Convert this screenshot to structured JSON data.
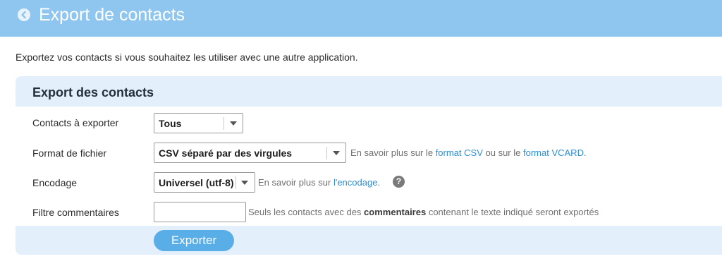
{
  "header": {
    "title": "Export de contacts",
    "back_icon": "back-arrow-circle-icon"
  },
  "intro": "Exportez vos contacts si vous souhaitez les utiliser avec une autre application.",
  "panel": {
    "title": "Export des contacts",
    "contacts": {
      "label": "Contacts à exporter",
      "value": "Tous"
    },
    "format": {
      "label": "Format de fichier",
      "value": "CSV séparé par des virgules",
      "help_prefix": "En savoir plus sur le",
      "link_csv": "format CSV",
      "help_middle": "ou sur le",
      "link_vcard": "format VCARD",
      "help_suffix": "."
    },
    "encoding": {
      "label": "Encodage",
      "value": "Universel (utf-8)",
      "help_prefix": "En savoir plus sur",
      "link": "l'encodage",
      "help_suffix": ".",
      "help_icon": "?"
    },
    "comments": {
      "label": "Filtre commentaires",
      "value": "",
      "help_prefix": "Seuls les contacts avec des",
      "help_bold": "commentaires",
      "help_suffix": "contenant le texte indiqué seront exportés"
    },
    "submit": "Exporter"
  },
  "colors": {
    "header": "#8ec6ef",
    "panel": "#e3f0fb",
    "link": "#2f8fd0",
    "button": "#5aaee8"
  }
}
